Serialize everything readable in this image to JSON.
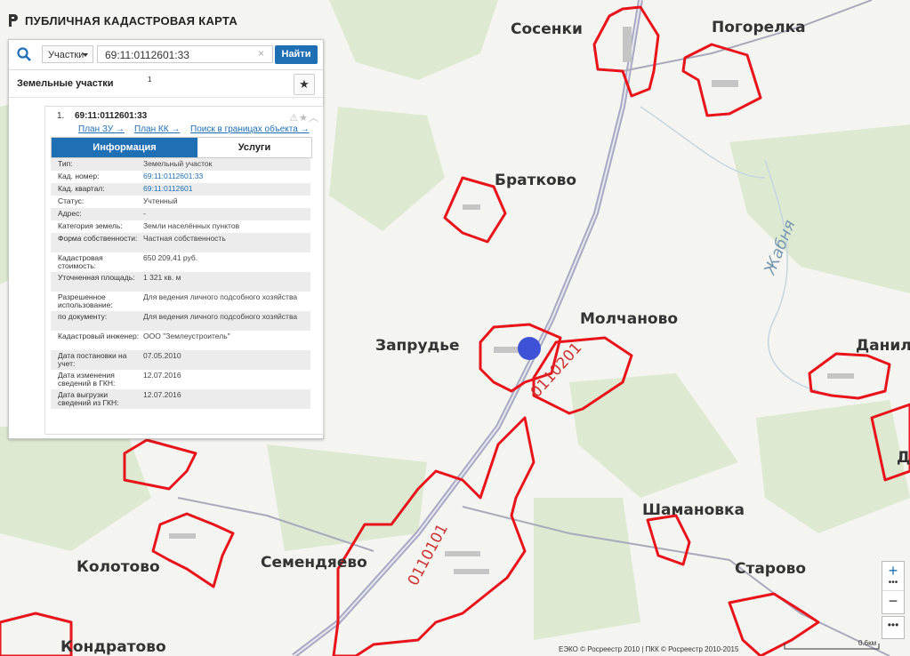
{
  "app": {
    "title": "ПУБЛИЧНАЯ КАДАСТРОВАЯ КАРТА"
  },
  "search": {
    "type_value": "Участки",
    "query": "69:11:0112601:33",
    "clear_symbol": "×",
    "find_label": "Найти"
  },
  "results": {
    "title": "Земельные участки",
    "count": "1",
    "star_symbol": "★"
  },
  "card": {
    "index": "1.",
    "cad_number": "69:11:0112601:33",
    "links": [
      "План ЗУ →",
      "План КК →",
      "Поиск в границах объекта →"
    ],
    "tabs": {
      "info": "Информация",
      "services": "Услуги"
    },
    "rows": [
      {
        "k": "Тип:",
        "v": "Земельный участок"
      },
      {
        "k": "Кад. номер:",
        "v": "69:11:0112601:33"
      },
      {
        "k": "Кад. квартал:",
        "v": "69:11:0112601"
      },
      {
        "k": "Статус:",
        "v": "Учтенный"
      },
      {
        "k": "Адрес:",
        "v": "-"
      },
      {
        "k": "Категория земель:",
        "v": "Земли населённых пунктов"
      },
      {
        "k": "Форма собственности:",
        "v": "Частная собственность"
      },
      {
        "k": "Кадастровая стоимость:",
        "v": "650 209,41 руб."
      },
      {
        "k": "Уточненная площадь:",
        "v": "1 321 кв. м"
      },
      {
        "k": "Разрешенное использование:",
        "v": "Для ведения личного подсобного хозяйства"
      },
      {
        "k": "по документу:",
        "v": "Для ведения личного подсобного хозяйства"
      },
      {
        "k": "Кадастровый инженер:",
        "v": "ООО \"Землеустроитель\""
      },
      {
        "k": "Дата постановки на учет:",
        "v": "07.05.2010"
      },
      {
        "k": "Дата изменения сведений в ГКН:",
        "v": "12.07.2016"
      },
      {
        "k": "Дата выгрузки сведений из ГКН:",
        "v": "12.07.2016"
      }
    ]
  },
  "map": {
    "places": [
      "Сосенки",
      "Погорелка",
      "Братково",
      "Молчаново",
      "Запрудье",
      "Даниловс",
      "Шамановка",
      "Семендяево",
      "Колотово",
      "Старово",
      "Кондратово",
      "Д"
    ],
    "river": "Жабня",
    "quarters": [
      "0110201",
      "0110101"
    ],
    "colors": {
      "parcel_border": "#e8141b",
      "road": "#9a9ab5",
      "forest": "#dbe8cf",
      "marker": "#3f51d6"
    }
  },
  "controls": {
    "zoom_in": "+",
    "dots": "•••",
    "zoom_out": "−",
    "more": "•••"
  },
  "footer": {
    "attribution": "ЕЭКО © Росреестр 2010 | ПКК © Росреестр 2010-2015",
    "scale": "0.6км"
  }
}
